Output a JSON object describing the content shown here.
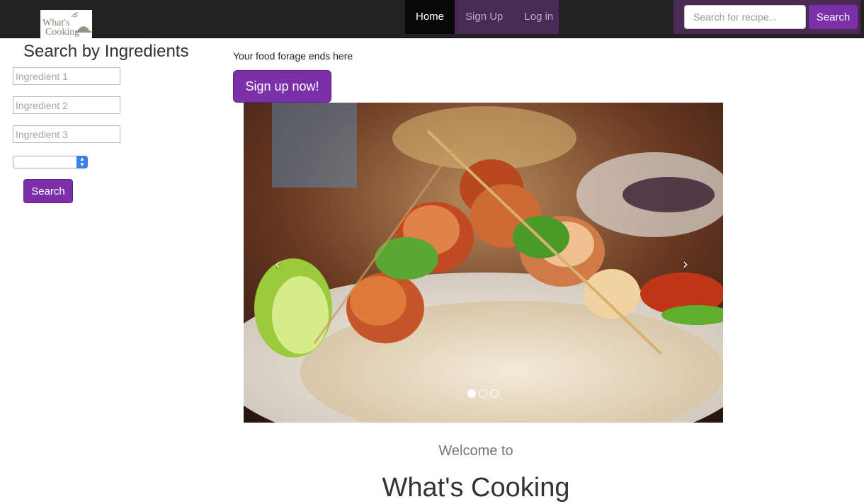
{
  "app": {
    "logo_text": "What's Cooking"
  },
  "navbar": {
    "links": [
      {
        "label": "Home",
        "active": true
      },
      {
        "label": "Sign Up",
        "active": false
      },
      {
        "label": "Log in",
        "active": false
      }
    ],
    "search": {
      "placeholder": "Search for recipe...",
      "button_label": "Search"
    }
  },
  "sidebar": {
    "title": "Search by Ingredients",
    "inputs": [
      {
        "placeholder": "Ingredient 1",
        "value": ""
      },
      {
        "placeholder": "Ingredient 2",
        "value": ""
      },
      {
        "placeholder": "Ingredient 3",
        "value": ""
      }
    ],
    "select": {
      "selected": ""
    },
    "search_label": "Search"
  },
  "hero": {
    "tagline": "Your food forage ends here",
    "cta_label": "Sign up now!",
    "carousel": {
      "prev_icon": "‹",
      "next_icon": "›",
      "slides_total": 3,
      "active_slide": 1
    }
  },
  "main": {
    "welcome_text": "Welcome to",
    "heading": "What's Cooking"
  },
  "colors": {
    "navbar_bg": "#222222",
    "nav_group_bg": "#4a2a54",
    "accent": "#7b2fa8"
  }
}
